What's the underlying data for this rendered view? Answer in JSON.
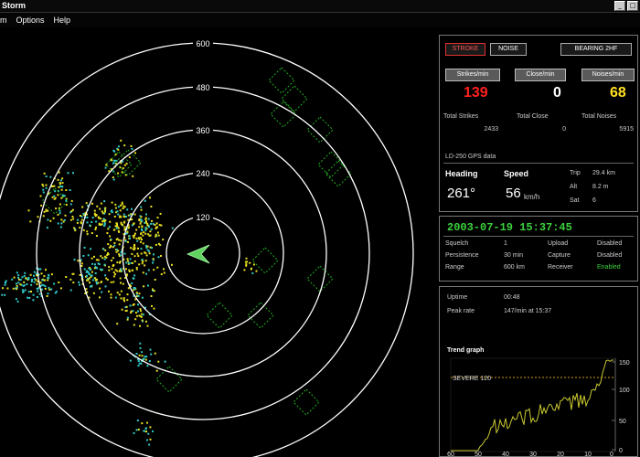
{
  "window": {
    "title": "Storm",
    "buttons": [
      "_",
      "□"
    ]
  },
  "menu": [
    "m",
    "Options",
    "Help"
  ],
  "radar": {
    "ring_labels": [
      "600",
      "480",
      "360",
      "240",
      "120"
    ],
    "ring_color": "#ffffff",
    "strike_colors": [
      "#e8e020",
      "#30c8c8"
    ],
    "noise_box_color": "#22b022"
  },
  "buttons": {
    "stroke": "STROKE",
    "noise": "NOISE",
    "bearing": "BEARING 2HF"
  },
  "rates": {
    "strikes_label": "Strikes/min",
    "strikes_value": "139",
    "close_label": "Close/min",
    "close_value": "0",
    "noises_label": "Noises/min",
    "noises_value": "68"
  },
  "totals": {
    "strikes_label": "Total Strikes",
    "strikes_value": "2433",
    "close_label": "Total Close",
    "close_value": "0",
    "noises_label": "Total Noises",
    "noises_value": "5915"
  },
  "gps": {
    "title": "LD-250 GPS data",
    "heading_label": "Heading",
    "heading_value": "261°",
    "speed_label": "Speed",
    "speed_value": "56",
    "speed_unit": "km/h",
    "trip_label": "Trip",
    "trip_value": "29.4 km",
    "alt_label": "Alt",
    "alt_value": "8.2 m",
    "sat_label": "Sat",
    "sat_value": "6"
  },
  "status": {
    "datetime": "2003-07-19 15:37:45",
    "squelch_label": "Squelch",
    "squelch_value": "1",
    "persistence_label": "Persistence",
    "persistence_value": "30 min",
    "range_label": "Range",
    "range_value": "600 km",
    "upload_label": "Upload",
    "upload_value": "Disabled",
    "capture_label": "Capture",
    "capture_value": "Disabled",
    "receiver_label": "Receiver",
    "receiver_value": "Enabled"
  },
  "trend": {
    "uptime_label": "Uptime",
    "uptime_value": "00:48",
    "peak_label": "Peak rate",
    "peak_value": "147/min at 15:37",
    "graph_title": "Trend graph",
    "severe_label": "SEVERE 120",
    "y_ticks": [
      "150",
      "100",
      "50",
      "0"
    ],
    "x_ticks": [
      "60",
      "50",
      "40",
      "30",
      "20",
      "10",
      "0"
    ],
    "line_color": "#c8c832"
  }
}
